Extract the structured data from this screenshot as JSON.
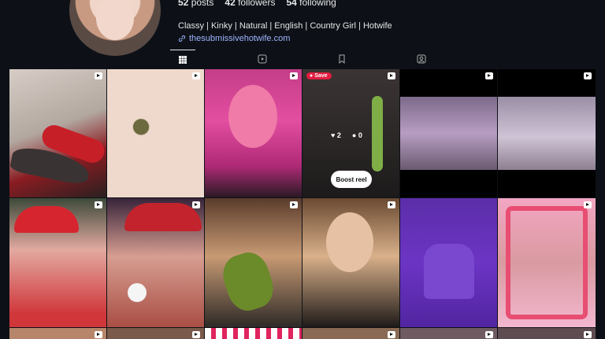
{
  "profile": {
    "stats": {
      "posts_count": "52",
      "posts_label": "posts",
      "followers_count": "42",
      "followers_label": "followers",
      "following_count": "54",
      "following_label": "following"
    },
    "bio": "Classy | Kinky | Natural | English | Country Girl | Hotwife",
    "link": "thesubmissivehotwife.com"
  },
  "tabs": [
    {
      "icon": "grid-icon",
      "active": true
    },
    {
      "icon": "reels-icon",
      "active": false
    },
    {
      "icon": "saved-icon",
      "active": false
    },
    {
      "icon": "tagged-icon",
      "active": false
    }
  ],
  "grid": {
    "save_label": "Save",
    "likes": "2",
    "comments": "0",
    "boost_label": "Boost reel"
  },
  "colors": {
    "background": "#0d1117",
    "link": "#9db4ff",
    "save_badge": "#e21d3f"
  }
}
